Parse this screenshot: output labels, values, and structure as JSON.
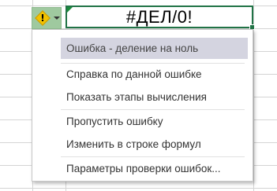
{
  "cell": {
    "value": "#ДЕЛ/0!"
  },
  "error_button": {
    "icon": "warning-diamond-icon",
    "glyph": "!"
  },
  "menu": {
    "header": "Ошибка  - деление на ноль",
    "items": [
      "Справка по данной ошибке",
      "Показать этапы вычисления",
      "Пропустить ошибку",
      "Изменить в строке формул",
      "Параметры проверки ошибок..."
    ]
  },
  "colors": {
    "selection_border": "#217346",
    "error_indicator": "#1a8a3a",
    "button_bg": "#9fc99f",
    "warning_icon": "#f2c200",
    "menu_highlight": "#d4d4e0"
  }
}
